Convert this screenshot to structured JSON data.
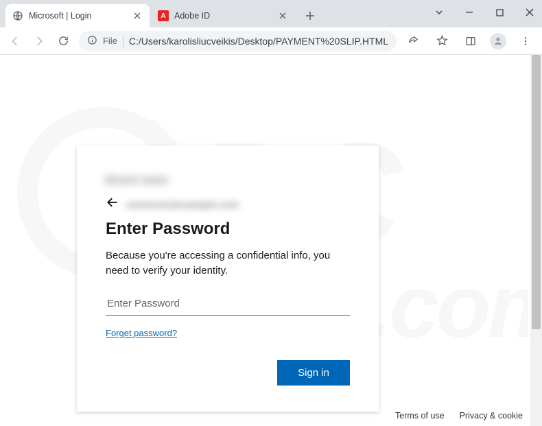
{
  "browser": {
    "tabs": [
      {
        "title": "Microsoft | Login",
        "active": true
      },
      {
        "title": "Adobe ID",
        "active": false
      }
    ],
    "address": {
      "scheme_label": "File",
      "path": "C:/Users/karolisliucveikis/Desktop/PAYMENT%20SLIP.HTML"
    }
  },
  "login": {
    "heading": "Enter Password",
    "description": "Because you're accessing a confidential info, you need to verify your identity.",
    "password_placeholder": "Enter Password",
    "forgot_label": "Forget password?",
    "signin_label": "Sign in"
  },
  "footer": {
    "terms": "Terms of use",
    "privacy": "Privacy & cookie"
  }
}
